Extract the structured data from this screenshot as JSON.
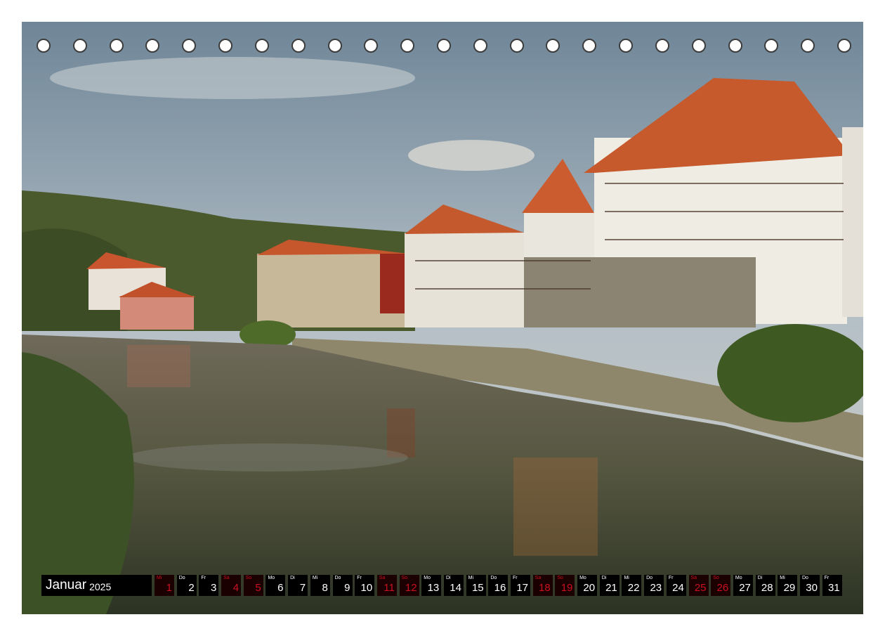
{
  "calendar": {
    "month": "Januar",
    "year": "2025",
    "days": [
      {
        "n": "1",
        "wd": "Mi",
        "we": true
      },
      {
        "n": "2",
        "wd": "Do",
        "we": false
      },
      {
        "n": "3",
        "wd": "Fr",
        "we": false
      },
      {
        "n": "4",
        "wd": "Sa",
        "we": true
      },
      {
        "n": "5",
        "wd": "So",
        "we": true
      },
      {
        "n": "6",
        "wd": "Mo",
        "we": false
      },
      {
        "n": "7",
        "wd": "Di",
        "we": false
      },
      {
        "n": "8",
        "wd": "Mi",
        "we": false
      },
      {
        "n": "9",
        "wd": "Do",
        "we": false
      },
      {
        "n": "10",
        "wd": "Fr",
        "we": false
      },
      {
        "n": "11",
        "wd": "Sa",
        "we": true
      },
      {
        "n": "12",
        "wd": "So",
        "we": true
      },
      {
        "n": "13",
        "wd": "Mo",
        "we": false
      },
      {
        "n": "14",
        "wd": "Di",
        "we": false
      },
      {
        "n": "15",
        "wd": "Mi",
        "we": false
      },
      {
        "n": "16",
        "wd": "Do",
        "we": false
      },
      {
        "n": "17",
        "wd": "Fr",
        "we": false
      },
      {
        "n": "18",
        "wd": "Sa",
        "we": true
      },
      {
        "n": "19",
        "wd": "So",
        "we": true
      },
      {
        "n": "20",
        "wd": "Mo",
        "we": false
      },
      {
        "n": "21",
        "wd": "Di",
        "we": false
      },
      {
        "n": "22",
        "wd": "Mi",
        "we": false
      },
      {
        "n": "23",
        "wd": "Do",
        "we": false
      },
      {
        "n": "24",
        "wd": "Fr",
        "we": false
      },
      {
        "n": "25",
        "wd": "Sa",
        "we": true
      },
      {
        "n": "26",
        "wd": "So",
        "we": true
      },
      {
        "n": "27",
        "wd": "Mo",
        "we": false
      },
      {
        "n": "28",
        "wd": "Di",
        "we": false
      },
      {
        "n": "29",
        "wd": "Mi",
        "we": false
      },
      {
        "n": "30",
        "wd": "Do",
        "we": false
      },
      {
        "n": "31",
        "wd": "Fr",
        "we": false
      }
    ]
  },
  "colors": {
    "weekend": "#cc1020",
    "weekday": "#ffffff",
    "cell": "#000000"
  },
  "binding_holes": 23
}
